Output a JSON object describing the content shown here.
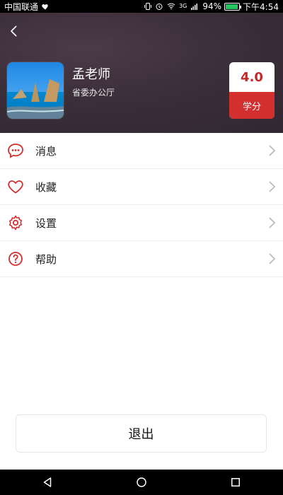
{
  "status_bar": {
    "carrier": "中国联通",
    "network_badge": "3G",
    "battery_percent": "94%",
    "battery_level": 0.94,
    "time": "下午4:54",
    "icons": [
      "heart-status-icon",
      "vibrate-icon",
      "alarm-icon",
      "wifi-icon",
      "signal-icon",
      "battery-icon"
    ]
  },
  "header": {
    "name": "孟老师",
    "department": "省委办公厅",
    "score": {
      "value": "4.0",
      "label": "学分"
    }
  },
  "menu": {
    "items": [
      {
        "label": "消息",
        "icon": "message-icon"
      },
      {
        "label": "收藏",
        "icon": "heart-icon"
      },
      {
        "label": "设置",
        "icon": "gear-icon"
      },
      {
        "label": "帮助",
        "icon": "help-icon"
      }
    ]
  },
  "logout": {
    "label": "退出"
  },
  "colors": {
    "accent": "#d32f2f",
    "header_bg": "#3a2e38",
    "divider": "#eeeeee"
  }
}
